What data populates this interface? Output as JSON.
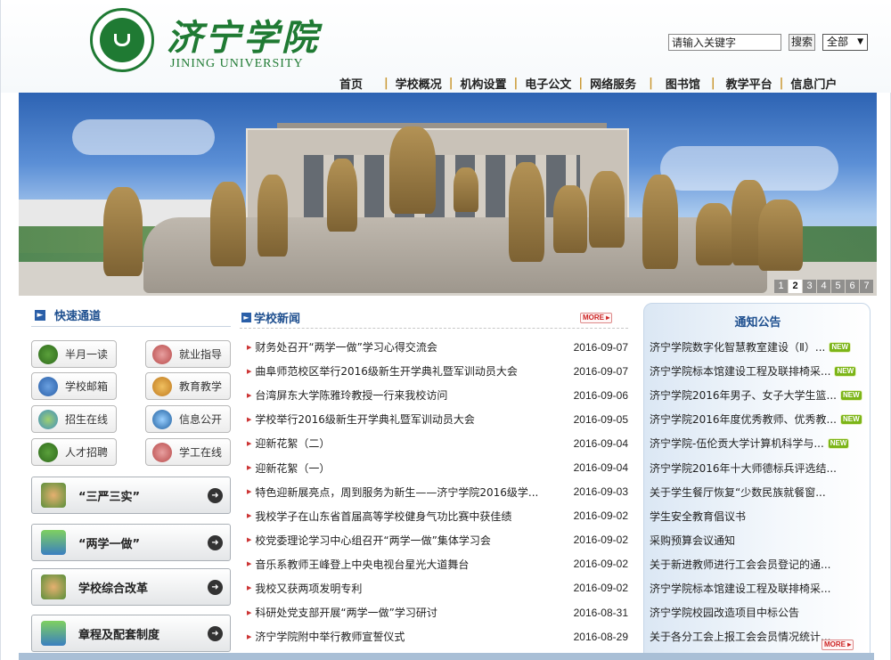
{
  "header": {
    "logo_name": "济宁学院",
    "logo_en": "JINING UNIVERSITY",
    "search": {
      "value": "请输入关键字",
      "button": "搜索",
      "scope": "全部"
    },
    "nav": [
      "首页",
      "学校概况",
      "机构设置",
      "电子公文",
      "网络服务",
      "图书馆",
      "教学平台",
      "信息门户"
    ]
  },
  "banner": {
    "slides": [
      "1",
      "2",
      "3",
      "4",
      "5",
      "6",
      "7"
    ],
    "active_slide": "2"
  },
  "quick_links": {
    "title": "快速通道",
    "buttons": [
      "半月一读",
      "就业指导",
      "学校邮箱",
      "教育教学",
      "招生在线",
      "信息公开",
      "人才招聘",
      "学工在线"
    ],
    "feature_buttons": [
      "“三严三实”",
      "“两学一做”",
      "学校综合改革",
      "章程及配套制度"
    ]
  },
  "news": {
    "title": "学校新闻",
    "more": "MORE",
    "items": [
      {
        "title": "财务处召开“两学一做”学习心得交流会",
        "date": "2016-09-07"
      },
      {
        "title": "曲阜师范校区举行2016级新生开学典礼暨军训动员大会",
        "date": "2016-09-07"
      },
      {
        "title": "台湾屏东大学陈雅玲教授一行来我校访问",
        "date": "2016-09-06"
      },
      {
        "title": "学校举行2016级新生开学典礼暨军训动员大会",
        "date": "2016-09-05"
      },
      {
        "title": "迎新花絮（二）",
        "date": "2016-09-04"
      },
      {
        "title": "迎新花絮（一）",
        "date": "2016-09-04"
      },
      {
        "title": "特色迎新展亮点，周到服务为新生——济宁学院2016级学...",
        "date": "2016-09-03"
      },
      {
        "title": "我校学子在山东省首届高等学校健身气功比赛中获佳绩",
        "date": "2016-09-02"
      },
      {
        "title": "校党委理论学习中心组召开“两学一做”集体学习会",
        "date": "2016-09-02"
      },
      {
        "title": "音乐系教师王峰登上中央电视台星光大道舞台",
        "date": "2016-09-02"
      },
      {
        "title": "我校又获两项发明专利",
        "date": "2016-09-02"
      },
      {
        "title": "科研处党支部开展“两学一做”学习研讨",
        "date": "2016-08-31"
      },
      {
        "title": "济宁学院附中举行教师宣誓仪式",
        "date": "2016-08-29"
      }
    ]
  },
  "notices": {
    "title": "通知公告",
    "more": "MORE",
    "new_badge": "NEW",
    "items": [
      {
        "title": "济宁学院数字化智慧教室建设（Ⅱ）...",
        "is_new": true
      },
      {
        "title": "济宁学院标本馆建设工程及联排椅采...",
        "is_new": true
      },
      {
        "title": "济宁学院2016年男子、女子大学生篮...",
        "is_new": true
      },
      {
        "title": "济宁学院2016年度优秀教师、优秀教...",
        "is_new": true
      },
      {
        "title": "济宁学院-伍伦贡大学计算机科学与...",
        "is_new": true
      },
      {
        "title": "济宁学院2016年十大师德标兵评选结...",
        "is_new": false
      },
      {
        "title": "关于学生餐厅恢复“少数民族就餐窗...",
        "is_new": false
      },
      {
        "title": "学生安全教育倡议书",
        "is_new": false
      },
      {
        "title": "采购预算会议通知",
        "is_new": false
      },
      {
        "title": "关于新进教师进行工会会员登记的通...",
        "is_new": false
      },
      {
        "title": "济宁学院标本馆建设工程及联排椅采...",
        "is_new": false
      },
      {
        "title": "济宁学院校园改造项目中标公告",
        "is_new": false
      },
      {
        "title": "关于各分工会上报工会会员情况统计...",
        "is_new": false
      }
    ]
  },
  "colors": {
    "brand_green": "#1f7a33",
    "title_blue": "#1e4f8f",
    "nav_separator": "#c9962e",
    "new_badge": "#7cb518"
  }
}
